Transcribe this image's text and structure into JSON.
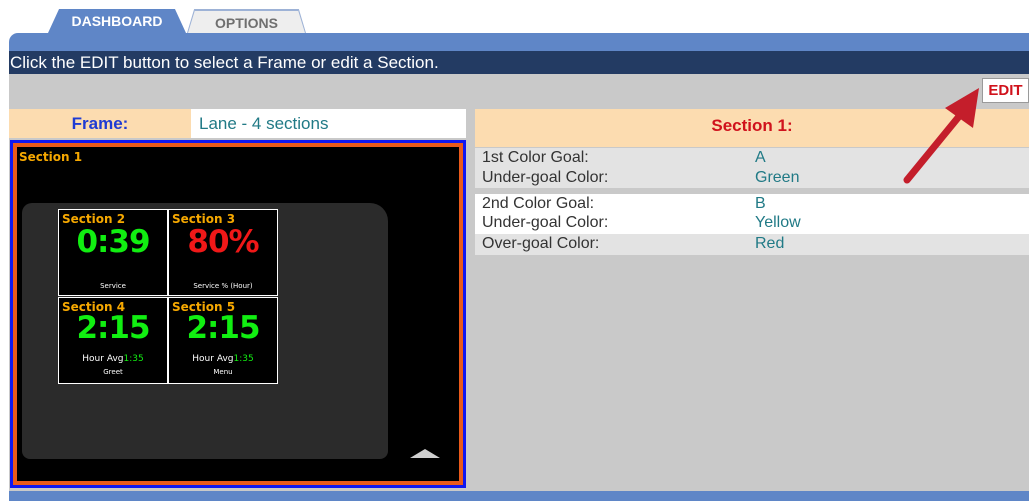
{
  "tabs": [
    {
      "label": "DASHBOARD",
      "active": true
    },
    {
      "label": "OPTIONS",
      "active": false
    }
  ],
  "instruction": "Click the EDIT button to select a Frame or edit a Section.",
  "edit_button": "EDIT",
  "frame": {
    "label": "Frame:",
    "value": "Lane - 4 sections"
  },
  "section_panel": {
    "title": "Section 1:",
    "rows": [
      {
        "label": "1st Color Goal:",
        "value": "A"
      },
      {
        "label": "Under-goal Color:",
        "value": "Green"
      },
      {
        "label": "2nd Color Goal:",
        "value": "B"
      },
      {
        "label": "Under-goal Color:",
        "value": "Yellow"
      },
      {
        "label": "Over-goal Color:",
        "value": "Red"
      }
    ]
  },
  "preview": {
    "title": "Section 1",
    "cells": [
      {
        "title": "Section 2",
        "value": "0:39",
        "value_color": "#11ee11",
        "caption": "Service"
      },
      {
        "title": "Section 3",
        "value": "80%",
        "value_color": "#f01818",
        "caption": "Service % (Hour)"
      },
      {
        "title": "Section 4",
        "value": "2:15",
        "value_color": "#11ee11",
        "avg_label": "Hour Avg",
        "avg_value": "1:35",
        "caption": "Greet"
      },
      {
        "title": "Section 5",
        "value": "2:15",
        "value_color": "#11ee11",
        "avg_label": "Hour Avg",
        "avg_value": "1:35",
        "caption": "Menu"
      }
    ]
  },
  "colors": {
    "accent": "#5f86c7",
    "dark_bar": "#233b63",
    "highlight": "#d0121c",
    "section_header_bg": "#fcdcb0",
    "arrow": "#c41e2b"
  },
  "icons": [
    "pointer-arrow-icon",
    "scroll-up-icon"
  ]
}
